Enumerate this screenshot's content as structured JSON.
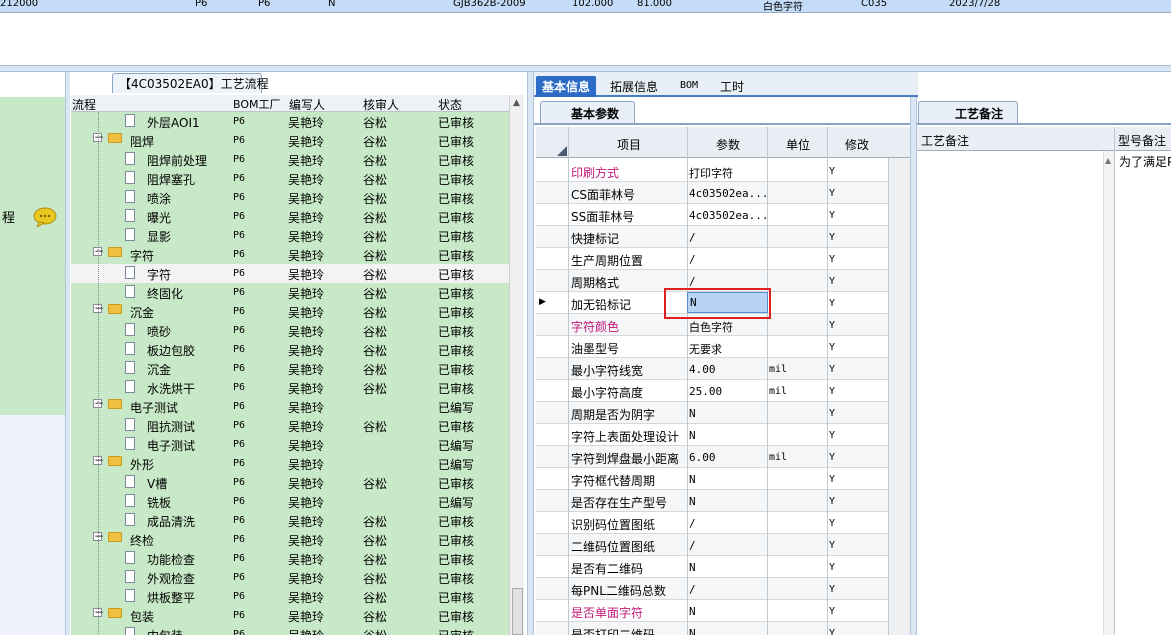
{
  "top_row": [
    "212000",
    "P6",
    "P6",
    "N",
    "GJB362B-2009",
    "102.000",
    "81.000",
    "白色字符",
    "C035",
    "2023/7/28"
  ],
  "left_panel": {
    "label": "程"
  },
  "process_tab": {
    "label": "【4C03502EA0】工艺流程"
  },
  "tree": {
    "columns": [
      "流程",
      "BOM工厂",
      "编写人",
      "核审人",
      "状态"
    ],
    "rows": [
      {
        "level": 2,
        "name": "外层AOI1",
        "bom": "P6",
        "writer": "吴艳玲",
        "reviewer": "谷松",
        "status": "已审核"
      },
      {
        "level": 1,
        "name": "阻焊",
        "bom": "P6",
        "writer": "吴艳玲",
        "reviewer": "谷松",
        "status": "已审核"
      },
      {
        "level": 2,
        "name": "阻焊前处理",
        "bom": "P6",
        "writer": "吴艳玲",
        "reviewer": "谷松",
        "status": "已审核"
      },
      {
        "level": 2,
        "name": "阻焊塞孔",
        "bom": "P6",
        "writer": "吴艳玲",
        "reviewer": "谷松",
        "status": "已审核"
      },
      {
        "level": 2,
        "name": "喷涂",
        "bom": "P6",
        "writer": "吴艳玲",
        "reviewer": "谷松",
        "status": "已审核"
      },
      {
        "level": 2,
        "name": "曝光",
        "bom": "P6",
        "writer": "吴艳玲",
        "reviewer": "谷松",
        "status": "已审核"
      },
      {
        "level": 2,
        "name": "显影",
        "bom": "P6",
        "writer": "吴艳玲",
        "reviewer": "谷松",
        "status": "已审核"
      },
      {
        "level": 1,
        "name": "字符",
        "bom": "P6",
        "writer": "吴艳玲",
        "reviewer": "谷松",
        "status": "已审核"
      },
      {
        "level": 2,
        "name": "字符",
        "bom": "P6",
        "writer": "吴艳玲",
        "reviewer": "谷松",
        "status": "已审核",
        "selected": true
      },
      {
        "level": 2,
        "name": "终固化",
        "bom": "P6",
        "writer": "吴艳玲",
        "reviewer": "谷松",
        "status": "已审核"
      },
      {
        "level": 1,
        "name": "沉金",
        "bom": "P6",
        "writer": "吴艳玲",
        "reviewer": "谷松",
        "status": "已审核"
      },
      {
        "level": 2,
        "name": "喷砂",
        "bom": "P6",
        "writer": "吴艳玲",
        "reviewer": "谷松",
        "status": "已审核"
      },
      {
        "level": 2,
        "name": "板边包胶",
        "bom": "P6",
        "writer": "吴艳玲",
        "reviewer": "谷松",
        "status": "已审核"
      },
      {
        "level": 2,
        "name": "沉金",
        "bom": "P6",
        "writer": "吴艳玲",
        "reviewer": "谷松",
        "status": "已审核"
      },
      {
        "level": 2,
        "name": "水洗烘干",
        "bom": "P6",
        "writer": "吴艳玲",
        "reviewer": "谷松",
        "status": "已审核"
      },
      {
        "level": 1,
        "name": "电子测试",
        "bom": "P6",
        "writer": "吴艳玲",
        "reviewer": "",
        "status": "已编写"
      },
      {
        "level": 2,
        "name": "阻抗测试",
        "bom": "P6",
        "writer": "吴艳玲",
        "reviewer": "谷松",
        "status": "已审核"
      },
      {
        "level": 2,
        "name": "电子测试",
        "bom": "P6",
        "writer": "吴艳玲",
        "reviewer": "",
        "status": "已编写"
      },
      {
        "level": 1,
        "name": "外形",
        "bom": "P6",
        "writer": "吴艳玲",
        "reviewer": "",
        "status": "已编写"
      },
      {
        "level": 2,
        "name": "V槽",
        "bom": "P6",
        "writer": "吴艳玲",
        "reviewer": "谷松",
        "status": "已审核"
      },
      {
        "level": 2,
        "name": "铣板",
        "bom": "P6",
        "writer": "吴艳玲",
        "reviewer": "",
        "status": "已编写"
      },
      {
        "level": 2,
        "name": "成品清洗",
        "bom": "P6",
        "writer": "吴艳玲",
        "reviewer": "谷松",
        "status": "已审核"
      },
      {
        "level": 1,
        "name": "终检",
        "bom": "P6",
        "writer": "吴艳玲",
        "reviewer": "谷松",
        "status": "已审核"
      },
      {
        "level": 2,
        "name": "功能检查",
        "bom": "P6",
        "writer": "吴艳玲",
        "reviewer": "谷松",
        "status": "已审核"
      },
      {
        "level": 2,
        "name": "外观检查",
        "bom": "P6",
        "writer": "吴艳玲",
        "reviewer": "谷松",
        "status": "已审核"
      },
      {
        "level": 2,
        "name": "烘板整平",
        "bom": "P6",
        "writer": "吴艳玲",
        "reviewer": "谷松",
        "status": "已审核"
      },
      {
        "level": 1,
        "name": "包装",
        "bom": "P6",
        "writer": "吴艳玲",
        "reviewer": "谷松",
        "status": "已审核"
      },
      {
        "level": 2,
        "name": "内包装",
        "bom": "P6",
        "writer": "吴艳玲",
        "reviewer": "谷松",
        "status": "已审核"
      }
    ]
  },
  "main_tabs": [
    "基本信息",
    "拓展信息",
    "BOM",
    "工时"
  ],
  "sub_tab": {
    "label": "基本参数"
  },
  "grid": {
    "columns": [
      "项目",
      "参数",
      "单位",
      "修改"
    ],
    "rows": [
      {
        "item": "印刷方式",
        "value": "打印字符",
        "unit": "",
        "mod": "Y",
        "pink": true
      },
      {
        "item": "CS面菲林号",
        "value": "4c03502ea...",
        "unit": "",
        "mod": "Y"
      },
      {
        "item": "SS面菲林号",
        "value": "4c03502ea...",
        "unit": "",
        "mod": "Y"
      },
      {
        "item": "快捷标记",
        "value": "/",
        "unit": "",
        "mod": "Y"
      },
      {
        "item": "生产周期位置",
        "value": "/",
        "unit": "",
        "mod": "Y"
      },
      {
        "item": "周期格式",
        "value": "/",
        "unit": "",
        "mod": "Y"
      },
      {
        "item": "加无铅标记",
        "value": "N",
        "unit": "",
        "mod": "Y",
        "current": true
      },
      {
        "item": "字符颜色",
        "value": "白色字符",
        "unit": "",
        "mod": "Y",
        "pink": true
      },
      {
        "item": "油墨型号",
        "value": "无要求",
        "unit": "",
        "mod": "Y"
      },
      {
        "item": "最小字符线宽",
        "value": "4.00",
        "unit": "mil",
        "mod": "Y"
      },
      {
        "item": "最小字符高度",
        "value": "25.00",
        "unit": "mil",
        "mod": "Y"
      },
      {
        "item": "周期是否为阴字",
        "value": "N",
        "unit": "",
        "mod": "Y"
      },
      {
        "item": "字符上表面处理设计",
        "value": "N",
        "unit": "",
        "mod": "Y"
      },
      {
        "item": "字符到焊盘最小距离",
        "value": "6.00",
        "unit": "mil",
        "mod": "Y"
      },
      {
        "item": "字符框代替周期",
        "value": "N",
        "unit": "",
        "mod": "Y"
      },
      {
        "item": "是否存在生产型号",
        "value": "N",
        "unit": "",
        "mod": "Y"
      },
      {
        "item": "识别码位置图纸",
        "value": "/",
        "unit": "",
        "mod": "Y"
      },
      {
        "item": "二维码位置图纸",
        "value": "/",
        "unit": "",
        "mod": "Y"
      },
      {
        "item": "是否有二维码",
        "value": "N",
        "unit": "",
        "mod": "Y"
      },
      {
        "item": "每PNL二维码总数",
        "value": "/",
        "unit": "",
        "mod": "Y"
      },
      {
        "item": "是否单面字符",
        "value": "N",
        "unit": "",
        "mod": "Y",
        "pink": true
      },
      {
        "item": "是否打印二维码",
        "value": "N",
        "unit": "",
        "mod": "Y"
      }
    ]
  },
  "right_tab": {
    "label": "工艺备注"
  },
  "right_panel": {
    "columns": [
      "工艺备注",
      "型号备注"
    ],
    "model_note": "为了满足P"
  },
  "colors": {
    "tree_bg": "#c8e9c8",
    "active_tab": "#2c6bc6",
    "pink_text": "#c2187a",
    "highlight": "#e02020"
  }
}
